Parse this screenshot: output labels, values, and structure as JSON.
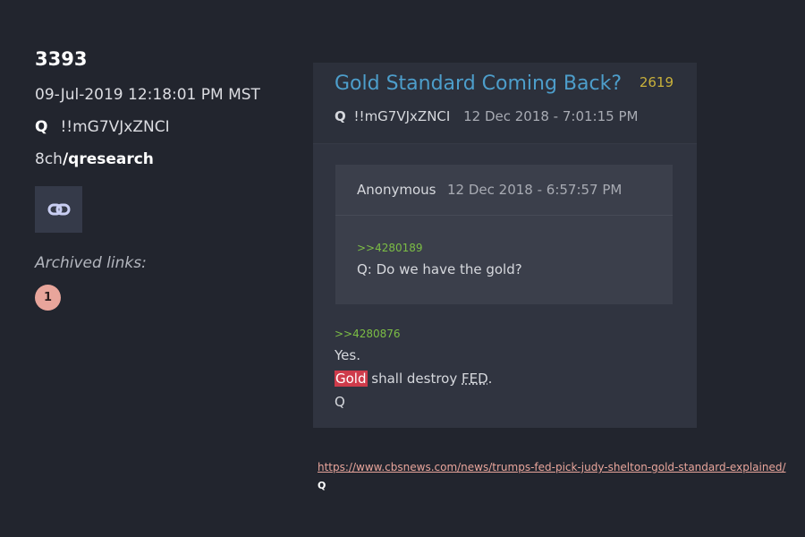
{
  "post": {
    "number": "3393",
    "date": "09-Jul-2019 12:18:01 PM MST",
    "author_q": "Q",
    "tripcode": "!!mG7VJxZNCI",
    "board_prefix": "8ch",
    "board": "/qresearch",
    "link_icon": "link-icon",
    "archived_label": "Archived links:",
    "archive_badge": "1"
  },
  "screenshot": {
    "title": "Gold Standard Coming Back?",
    "count": "2619",
    "author_q": "Q",
    "tripcode": "!!mG7VJxZNCI",
    "date": "12 Dec 2018 - 7:01:15 PM",
    "quoted": {
      "name": "Anonymous",
      "date": "12 Dec 2018 - 6:57:57 PM",
      "link": ">>4280189",
      "text": "Q: Do we have the gold?"
    },
    "reply_link": ">>4280876",
    "line1": "Yes.",
    "line2_highlight": "Gold",
    "line2_middle": " shall destroy ",
    "line2_fed": "FED",
    "line2_end": ".",
    "line3": "Q"
  },
  "footer": {
    "url": "https://www.cbsnews.com/news/trumps-fed-pick-judy-shelton-gold-standard-explained/",
    "signature": "Q"
  },
  "colors": {
    "background": "#22252e",
    "title_blue": "#4d9ecb",
    "greentext": "#7cbd45",
    "highlight": "#ce3b4b",
    "badge": "#e8a59b"
  }
}
